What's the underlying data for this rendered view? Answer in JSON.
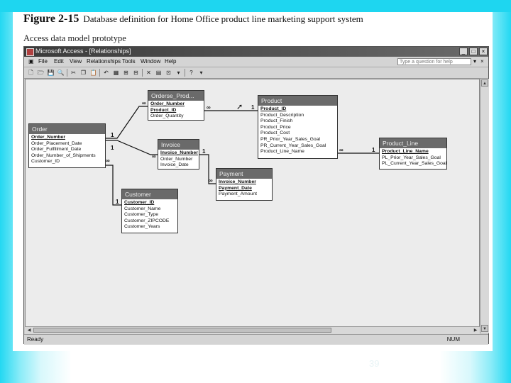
{
  "figure": {
    "number": "Figure 2-15",
    "title": "Database definition for Home Office product line marketing support system",
    "subtitle": "Access data model prototype"
  },
  "window": {
    "title": "Microsoft Access - [Relationships]",
    "controls": [
      "_",
      "□",
      "×"
    ]
  },
  "menu": {
    "items": [
      "File",
      "Edit",
      "View",
      "Relationships",
      "Tools",
      "Window",
      "Help"
    ],
    "question_placeholder": "Type a question for help"
  },
  "status": {
    "left": "Ready",
    "right": "NUM"
  },
  "slide_number": "39",
  "tables": {
    "order_product": {
      "name": "Orderse_Prod...",
      "fields": [
        "Order_Number",
        "Product_ID",
        "Order_Quantity"
      ],
      "pk": 2
    },
    "product": {
      "name": "Product",
      "fields": [
        "Product_ID",
        "Product_Description",
        "Product_Finish",
        "Product_Price",
        "Product_Cost",
        "PR_Prior_Year_Sales_Goal",
        "PR_Current_Year_Sales_Goal",
        "Product_Line_Name"
      ],
      "pk": 1
    },
    "order": {
      "name": "Order",
      "fields": [
        "Order_Number",
        "Order_Placement_Date",
        "Order_Fulfillment_Date",
        "Order_Number_of_Shipments",
        "Customer_ID"
      ],
      "pk": 1
    },
    "invoice": {
      "name": "Invoice",
      "fields": [
        "Invoice_Number",
        "Order_Number",
        "Invoice_Date"
      ],
      "pk": 1
    },
    "payment": {
      "name": "Payment",
      "fields": [
        "Invoice_Number",
        "Payment_Date",
        "Payment_Amount"
      ],
      "pk": 2
    },
    "product_line": {
      "name": "Product_Line",
      "fields": [
        "Product_Line_Name",
        "PL_Prior_Year_Sales_Goal",
        "PL_Current_Year_Sales_Goal"
      ],
      "pk": 1
    },
    "customer": {
      "name": "Customer",
      "fields": [
        "Customer_ID",
        "Customer_Name",
        "Customer_Type",
        "Customer_ZIPCODE",
        "Customer_Years"
      ],
      "pk": 1
    }
  },
  "cardinality": {
    "one": "1",
    "many": "∞"
  }
}
